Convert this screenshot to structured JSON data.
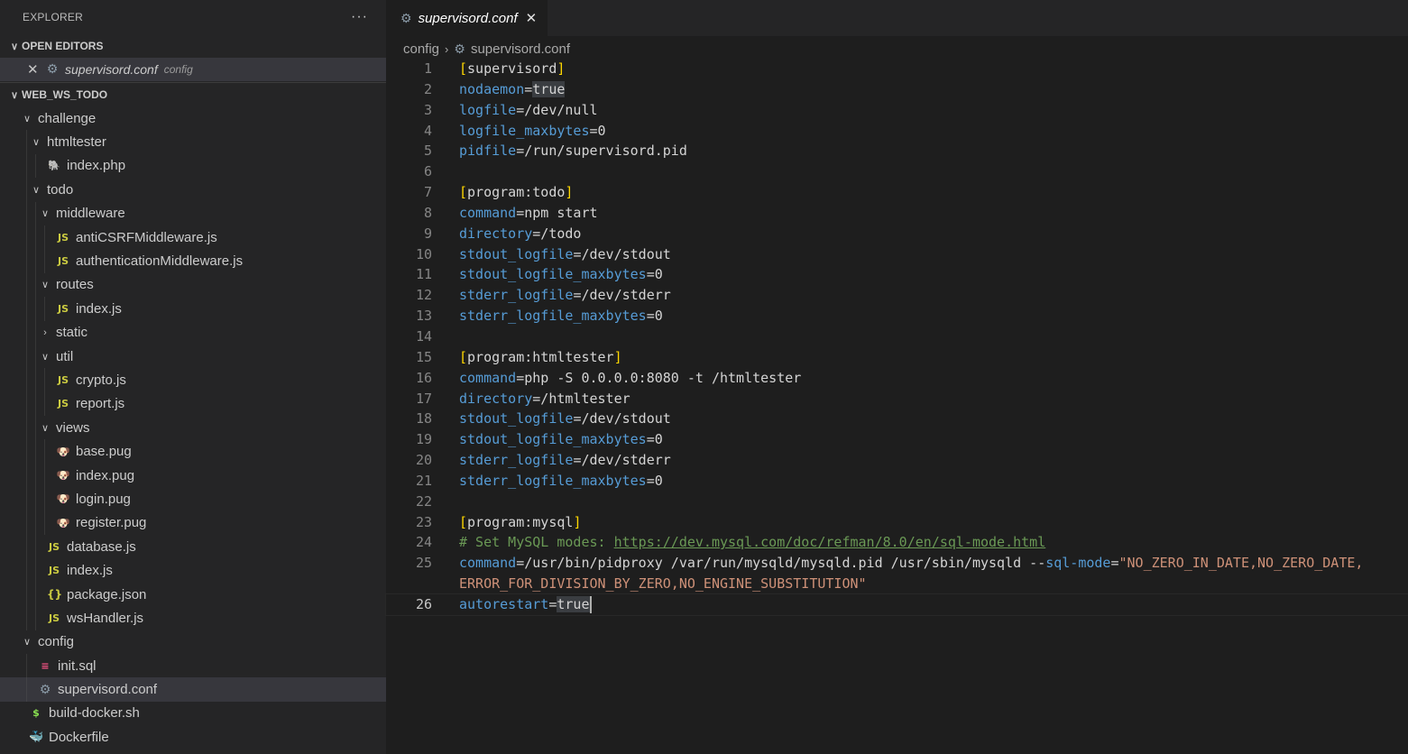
{
  "sidebar": {
    "title": "EXPLORER",
    "more_icon": "···",
    "open_editors": {
      "label": "OPEN EDITORS",
      "items": [
        {
          "name": "supervisord.conf",
          "desc": "config"
        }
      ]
    },
    "workspace": {
      "label": "WEB_WS_TODO"
    },
    "tree": [
      {
        "label": "challenge",
        "type": "folder",
        "open": true
      },
      {
        "label": "htmltester",
        "type": "folder",
        "open": true
      },
      {
        "label": "index.php",
        "type": "php"
      },
      {
        "label": "todo",
        "type": "folder",
        "open": true
      },
      {
        "label": "middleware",
        "type": "folder",
        "open": true
      },
      {
        "label": "antiCSRFMiddleware.js",
        "type": "js"
      },
      {
        "label": "authenticationMiddleware.js",
        "type": "js"
      },
      {
        "label": "routes",
        "type": "folder",
        "open": true
      },
      {
        "label": "index.js",
        "type": "js"
      },
      {
        "label": "static",
        "type": "folder",
        "open": false
      },
      {
        "label": "util",
        "type": "folder",
        "open": true
      },
      {
        "label": "crypto.js",
        "type": "js"
      },
      {
        "label": "report.js",
        "type": "js"
      },
      {
        "label": "views",
        "type": "folder",
        "open": true
      },
      {
        "label": "base.pug",
        "type": "pug"
      },
      {
        "label": "index.pug",
        "type": "pug"
      },
      {
        "label": "login.pug",
        "type": "pug"
      },
      {
        "label": "register.pug",
        "type": "pug"
      },
      {
        "label": "database.js",
        "type": "js"
      },
      {
        "label": "index.js",
        "type": "js"
      },
      {
        "label": "package.json",
        "type": "json"
      },
      {
        "label": "wsHandler.js",
        "type": "js"
      },
      {
        "label": "config",
        "type": "folder",
        "open": true
      },
      {
        "label": "init.sql",
        "type": "sql"
      },
      {
        "label": "supervisord.conf",
        "type": "conf",
        "selected": true
      },
      {
        "label": "build-docker.sh",
        "type": "sh"
      },
      {
        "label": "Dockerfile",
        "type": "docker"
      }
    ]
  },
  "editor": {
    "tab": {
      "label": "supervisord.conf",
      "close": "✕"
    },
    "breadcrumb": {
      "folder": "config",
      "separator": "›",
      "file": "supervisord.conf"
    },
    "current_line": 26,
    "lines": [
      {
        "n": 1,
        "segs": [
          [
            "[",
            "br"
          ],
          [
            "supervisord",
            "sec"
          ],
          [
            "]",
            "br"
          ]
        ]
      },
      {
        "n": 2,
        "segs": [
          [
            "nodaemon",
            "key"
          ],
          [
            "=",
            "val"
          ],
          [
            "true",
            "hl"
          ]
        ]
      },
      {
        "n": 3,
        "segs": [
          [
            "logfile",
            "key"
          ],
          [
            "=/dev/null",
            "val"
          ]
        ]
      },
      {
        "n": 4,
        "segs": [
          [
            "logfile_maxbytes",
            "key"
          ],
          [
            "=0",
            "val"
          ]
        ]
      },
      {
        "n": 5,
        "segs": [
          [
            "pidfile",
            "key"
          ],
          [
            "=/run/supervisord.pid",
            "val"
          ]
        ]
      },
      {
        "n": 6,
        "segs": []
      },
      {
        "n": 7,
        "segs": [
          [
            "[",
            "br"
          ],
          [
            "program:todo",
            "sec"
          ],
          [
            "]",
            "br"
          ]
        ]
      },
      {
        "n": 8,
        "segs": [
          [
            "command",
            "key"
          ],
          [
            "=npm start",
            "val"
          ]
        ]
      },
      {
        "n": 9,
        "segs": [
          [
            "directory",
            "key"
          ],
          [
            "=/todo",
            "val"
          ]
        ]
      },
      {
        "n": 10,
        "segs": [
          [
            "stdout_logfile",
            "key"
          ],
          [
            "=/dev/stdout",
            "val"
          ]
        ]
      },
      {
        "n": 11,
        "segs": [
          [
            "stdout_logfile_maxbytes",
            "key"
          ],
          [
            "=0",
            "val"
          ]
        ]
      },
      {
        "n": 12,
        "segs": [
          [
            "stderr_logfile",
            "key"
          ],
          [
            "=/dev/stderr",
            "val"
          ]
        ]
      },
      {
        "n": 13,
        "segs": [
          [
            "stderr_logfile_maxbytes",
            "key"
          ],
          [
            "=0",
            "val"
          ]
        ]
      },
      {
        "n": 14,
        "segs": []
      },
      {
        "n": 15,
        "segs": [
          [
            "[",
            "br"
          ],
          [
            "program:htmltester",
            "sec"
          ],
          [
            "]",
            "br"
          ]
        ]
      },
      {
        "n": 16,
        "segs": [
          [
            "command",
            "key"
          ],
          [
            "=php -S 0.0.0.0:8080 -t /htmltester",
            "val"
          ]
        ]
      },
      {
        "n": 17,
        "segs": [
          [
            "directory",
            "key"
          ],
          [
            "=/htmltester",
            "val"
          ]
        ]
      },
      {
        "n": 18,
        "segs": [
          [
            "stdout_logfile",
            "key"
          ],
          [
            "=/dev/stdout",
            "val"
          ]
        ]
      },
      {
        "n": 19,
        "segs": [
          [
            "stdout_logfile_maxbytes",
            "key"
          ],
          [
            "=0",
            "val"
          ]
        ]
      },
      {
        "n": 20,
        "segs": [
          [
            "stderr_logfile",
            "key"
          ],
          [
            "=/dev/stderr",
            "val"
          ]
        ]
      },
      {
        "n": 21,
        "segs": [
          [
            "stderr_logfile_maxbytes",
            "key"
          ],
          [
            "=0",
            "val"
          ]
        ]
      },
      {
        "n": 22,
        "segs": []
      },
      {
        "n": 23,
        "segs": [
          [
            "[",
            "br"
          ],
          [
            "program:mysql",
            "sec"
          ],
          [
            "]",
            "br"
          ]
        ]
      },
      {
        "n": 24,
        "segs": [
          [
            "# Set MySQL modes: ",
            "com"
          ],
          [
            "https://dev.mysql.com/doc/refman/8.0/en/sql-mode.html",
            "url"
          ]
        ]
      },
      {
        "n": 25,
        "segs": [
          [
            "command",
            "key"
          ],
          [
            "=/usr/bin/pidproxy /var/run/mysqld/mysqld.pid /usr/sbin/mysqld --",
            "val"
          ],
          [
            "sql-mode",
            "key"
          ],
          [
            "=",
            "val"
          ],
          [
            "\"NO_ZERO_IN_DATE,NO_ZERO_DATE,",
            "str"
          ]
        ]
      },
      {
        "n": "",
        "segs": [
          [
            "ERROR_FOR_DIVISION_BY_ZERO,NO_ENGINE_SUBSTITUTION\"",
            "str"
          ]
        ]
      },
      {
        "n": 26,
        "segs": [
          [
            "autorestart",
            "key"
          ],
          [
            "=",
            "val"
          ],
          [
            "true",
            "hl"
          ]
        ]
      }
    ]
  },
  "colors": {
    "key": "#569cd6",
    "bracket": "#ffd700",
    "string": "#ce9178",
    "comment": "#6a9955"
  },
  "icons": {
    "js": "JS",
    "json": "{}",
    "php": "php-elephant-icon",
    "pug": "pug-icon",
    "sql": "database-icon",
    "conf": "gear-icon",
    "sh": "$",
    "docker": "docker-whale-icon"
  }
}
